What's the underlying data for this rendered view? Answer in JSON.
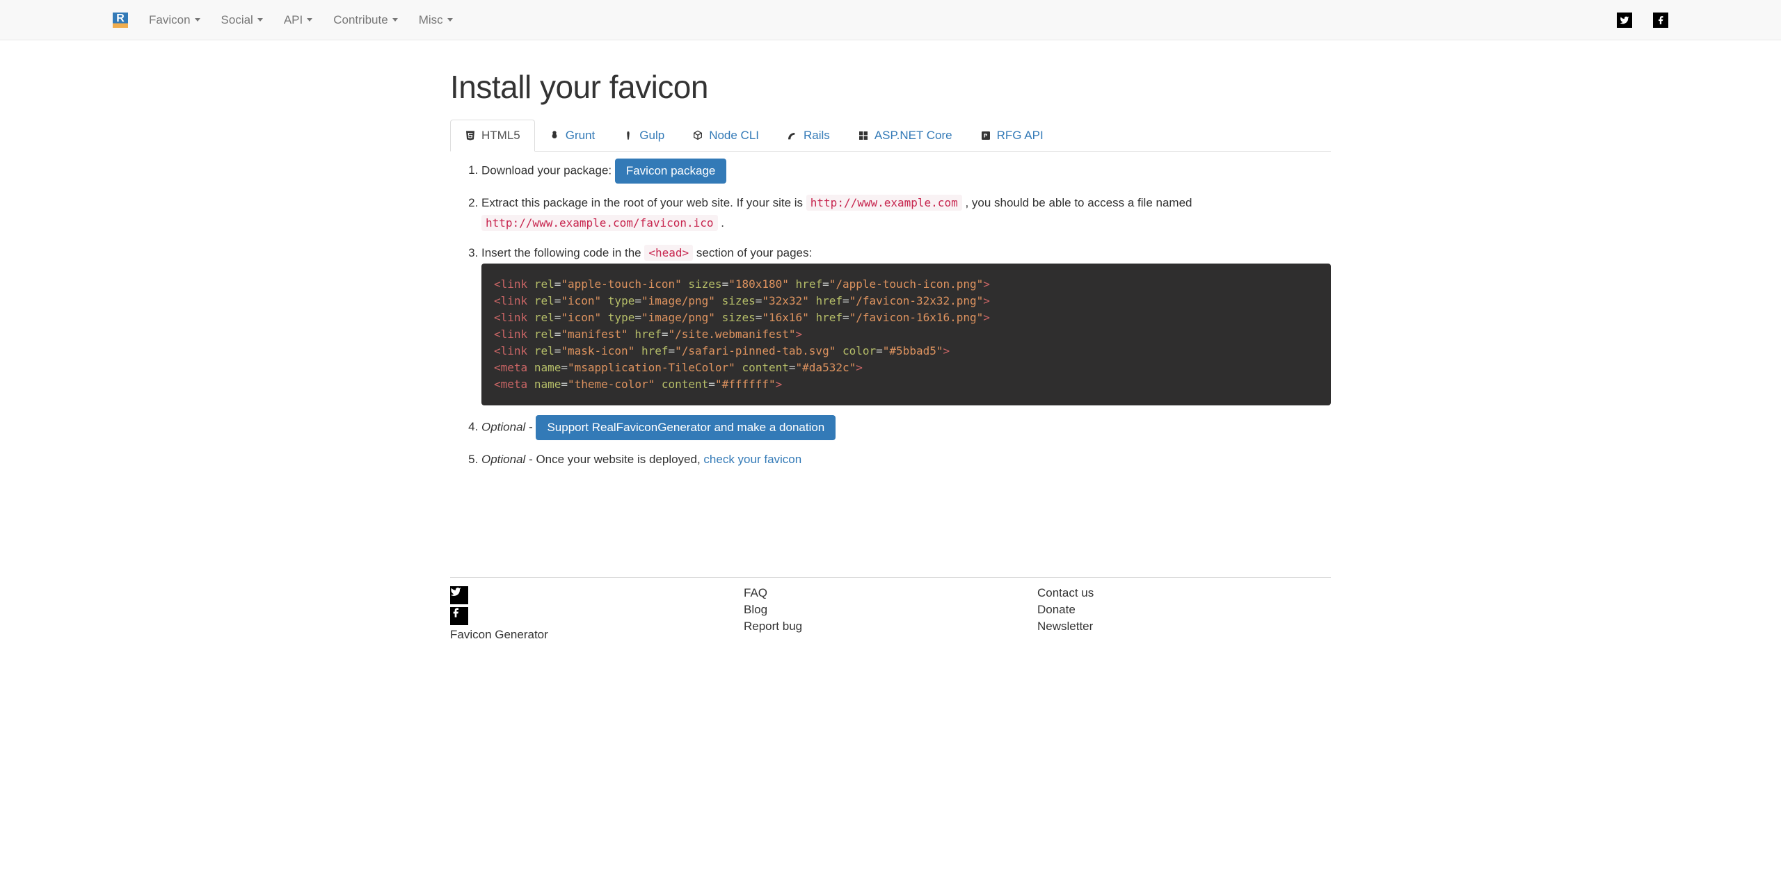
{
  "nav": {
    "items": [
      {
        "label": "Favicon"
      },
      {
        "label": "Social"
      },
      {
        "label": "API"
      },
      {
        "label": "Contribute"
      },
      {
        "label": "Misc"
      }
    ]
  },
  "page": {
    "title": "Install your favicon"
  },
  "tabs": [
    {
      "label": "HTML5",
      "icon": "html5"
    },
    {
      "label": "Grunt",
      "icon": "grunt"
    },
    {
      "label": "Gulp",
      "icon": "gulp"
    },
    {
      "label": "Node CLI",
      "icon": "node"
    },
    {
      "label": "Rails",
      "icon": "rails"
    },
    {
      "label": "ASP.NET Core",
      "icon": "aspnet"
    },
    {
      "label": "RFG API",
      "icon": "rfg"
    }
  ],
  "steps": {
    "s1_text": "Download your package: ",
    "s1_button": "Favicon package",
    "s2_a": "Extract this package in the root of your web site. If your site is ",
    "s2_code1": "http://www.example.com",
    "s2_b": ", you should be able to access a file named ",
    "s2_code2": "http://www.example.com/favicon.ico",
    "s2_c": ".",
    "s3_a": "Insert the following code in the ",
    "s3_code": "<head>",
    "s3_b": " section of your pages:",
    "s4_em": "Optional",
    "s4_dash": " - ",
    "s4_button": "Support RealFaviconGenerator and make a donation",
    "s5_em": "Optional",
    "s5_a": " - Once your website is deployed, ",
    "s5_link": "check your favicon"
  },
  "code_lines": [
    [
      [
        "tag",
        "<link"
      ],
      [
        "punc",
        " "
      ],
      [
        "attr",
        "rel"
      ],
      [
        "punc",
        "="
      ],
      [
        "str",
        "\"apple-touch-icon\""
      ],
      [
        "punc",
        " "
      ],
      [
        "attr",
        "sizes"
      ],
      [
        "punc",
        "="
      ],
      [
        "str",
        "\"180x180\""
      ],
      [
        "punc",
        " "
      ],
      [
        "attr",
        "href"
      ],
      [
        "punc",
        "="
      ],
      [
        "str",
        "\"/apple-touch-icon.png\""
      ],
      [
        "tag",
        ">"
      ]
    ],
    [
      [
        "tag",
        "<link"
      ],
      [
        "punc",
        " "
      ],
      [
        "attr",
        "rel"
      ],
      [
        "punc",
        "="
      ],
      [
        "str",
        "\"icon\""
      ],
      [
        "punc",
        " "
      ],
      [
        "attr",
        "type"
      ],
      [
        "punc",
        "="
      ],
      [
        "str",
        "\"image/png\""
      ],
      [
        "punc",
        " "
      ],
      [
        "attr",
        "sizes"
      ],
      [
        "punc",
        "="
      ],
      [
        "str",
        "\"32x32\""
      ],
      [
        "punc",
        " "
      ],
      [
        "attr",
        "href"
      ],
      [
        "punc",
        "="
      ],
      [
        "str",
        "\"/favicon-32x32.png\""
      ],
      [
        "tag",
        ">"
      ]
    ],
    [
      [
        "tag",
        "<link"
      ],
      [
        "punc",
        " "
      ],
      [
        "attr",
        "rel"
      ],
      [
        "punc",
        "="
      ],
      [
        "str",
        "\"icon\""
      ],
      [
        "punc",
        " "
      ],
      [
        "attr",
        "type"
      ],
      [
        "punc",
        "="
      ],
      [
        "str",
        "\"image/png\""
      ],
      [
        "punc",
        " "
      ],
      [
        "attr",
        "sizes"
      ],
      [
        "punc",
        "="
      ],
      [
        "str",
        "\"16x16\""
      ],
      [
        "punc",
        " "
      ],
      [
        "attr",
        "href"
      ],
      [
        "punc",
        "="
      ],
      [
        "str",
        "\"/favicon-16x16.png\""
      ],
      [
        "tag",
        ">"
      ]
    ],
    [
      [
        "tag",
        "<link"
      ],
      [
        "punc",
        " "
      ],
      [
        "attr",
        "rel"
      ],
      [
        "punc",
        "="
      ],
      [
        "str",
        "\"manifest\""
      ],
      [
        "punc",
        " "
      ],
      [
        "attr",
        "href"
      ],
      [
        "punc",
        "="
      ],
      [
        "str",
        "\"/site.webmanifest\""
      ],
      [
        "tag",
        ">"
      ]
    ],
    [
      [
        "tag",
        "<link"
      ],
      [
        "punc",
        " "
      ],
      [
        "attr",
        "rel"
      ],
      [
        "punc",
        "="
      ],
      [
        "str",
        "\"mask-icon\""
      ],
      [
        "punc",
        " "
      ],
      [
        "attr",
        "href"
      ],
      [
        "punc",
        "="
      ],
      [
        "str",
        "\"/safari-pinned-tab.svg\""
      ],
      [
        "punc",
        " "
      ],
      [
        "attr",
        "color"
      ],
      [
        "punc",
        "="
      ],
      [
        "str",
        "\"#5bbad5\""
      ],
      [
        "tag",
        ">"
      ]
    ],
    [
      [
        "tag",
        "<meta"
      ],
      [
        "punc",
        " "
      ],
      [
        "attr",
        "name"
      ],
      [
        "punc",
        "="
      ],
      [
        "str",
        "\"msapplication-TileColor\""
      ],
      [
        "punc",
        " "
      ],
      [
        "attr",
        "content"
      ],
      [
        "punc",
        "="
      ],
      [
        "str",
        "\"#da532c\""
      ],
      [
        "tag",
        ">"
      ]
    ],
    [
      [
        "tag",
        "<meta"
      ],
      [
        "punc",
        " "
      ],
      [
        "attr",
        "name"
      ],
      [
        "punc",
        "="
      ],
      [
        "str",
        "\"theme-color\""
      ],
      [
        "punc",
        " "
      ],
      [
        "attr",
        "content"
      ],
      [
        "punc",
        "="
      ],
      [
        "str",
        "\"#ffffff\""
      ],
      [
        "tag",
        ">"
      ]
    ]
  ],
  "footer": {
    "col1_title": "Favicon Generator",
    "col2": [
      "FAQ",
      "Blog",
      "Report bug"
    ],
    "col3": [
      "Contact us",
      "Donate",
      "Newsletter"
    ]
  }
}
